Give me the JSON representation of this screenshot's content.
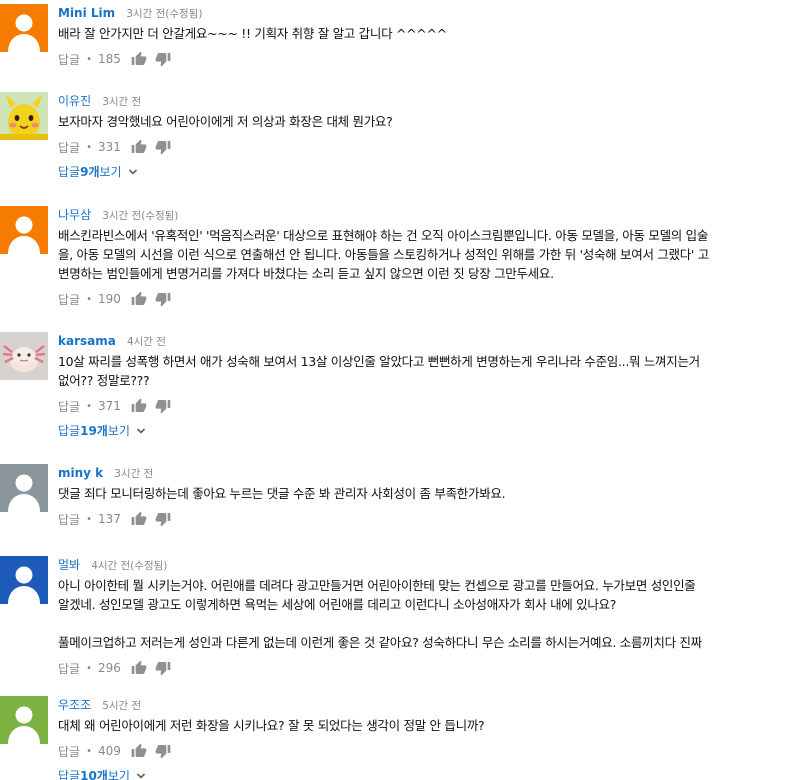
{
  "labels": {
    "reply": "답글",
    "dot": "•",
    "view_prefix": "답글 ",
    "view_suffix": " 보기"
  },
  "colors": {
    "author_link": "#1a73c8",
    "meta_gray": "#888888",
    "avatar_orange": "#f57c00",
    "avatar_gray": "#8a969c",
    "avatar_blue": "#1e5bb8",
    "avatar_green": "#7cb342"
  },
  "comments": [
    {
      "author": "Mini Lim",
      "time": "3시간 전(수정됨)",
      "text": "배라 잘 안가지만 더 안갈게요~~~ !! 기획자 취향 잘 알고 갑니다 ^^^^^",
      "likes": "185",
      "avatar": "default-orange-avatar"
    },
    {
      "author": "이유진",
      "time": "3시간 전",
      "text": "보자마자 경악했네요 어린아이에게 저 의상과 화장은 대체 뭔가요?",
      "likes": "331",
      "avatar": "yellow-character-avatar",
      "replies_count": "9개"
    },
    {
      "author": "나무삼",
      "time": "3시간 전(수정됨)",
      "text_lines": [
        "배스킨라빈스에서 '유혹적인' '먹음직스러운' 대상으로 표현해야 하는 건 오직 아이스크림뿐입니다. 아동 모델을, 아동 모델의 입술",
        "을, 아동 모델의 시선을 이런 식으로 연출해선 안 됩니다. 아동들을 스토킹하거나 성적인 위해를 가한 뒤 '성숙해 보여서 그랬다' 고",
        "변명하는 범인들에게 변명거리를 가져다 바쳤다는 소리 듣고 싶지 않으면 이런 짓 당장 그만두세요."
      ],
      "likes": "190",
      "avatar": "default-orange-avatar"
    },
    {
      "author": "karsama",
      "time": "4시간 전",
      "text_lines": [
        "10살 짜리를 성폭행 하면서 애가 성숙해 보여서 13살 이상인줄 알았다고 뻔뻔하게 변명하는게 우리나라 수준임...뭐 느껴지는거",
        "없어?? 정말로???"
      ],
      "likes": "371",
      "avatar": "axolotl-avatar",
      "replies_count": "19개"
    },
    {
      "author": "miny k",
      "time": "3시간 전",
      "text": "댓글 죄다 모니터링하는데 좋아요 누르는 댓글 수준 봐 관리자 사회성이 좀 부족한가봐요.",
      "likes": "137",
      "avatar": "default-gray-avatar"
    },
    {
      "author": "멀봐",
      "time": "4시간 전(수정됨)",
      "text_lines": [
        "아니 아이한테 뭘 시키는거야. 어린애를 데려다 광고만들거면 어린아이한테 맞는 컨셉으로 광고를 만들어요. 누가보면 성인인줄",
        "알겠네. 성인모델 광고도 이렇게하면 욕먹는 세상에 어린애를 데리고 이런다니 소아성애자가 회사 내에 있나요?"
      ],
      "text2": "풀메이크업하고 저러는게 성인과 다른게 없는데 이런게 좋은 것 같아요? 성숙하다니 무슨 소리를 하시는거예요. 소름끼치다 진짜",
      "likes": "296",
      "avatar": "default-blue-avatar"
    },
    {
      "author": "우조조",
      "time": "5시간 전",
      "text": "대체 왜 어린아이에게 저런 화장을 시키나요? 잘 못 되었다는 생각이 정말 안 듭니까?",
      "likes": "409",
      "avatar": "default-green-avatar",
      "replies_count": "10개"
    }
  ]
}
